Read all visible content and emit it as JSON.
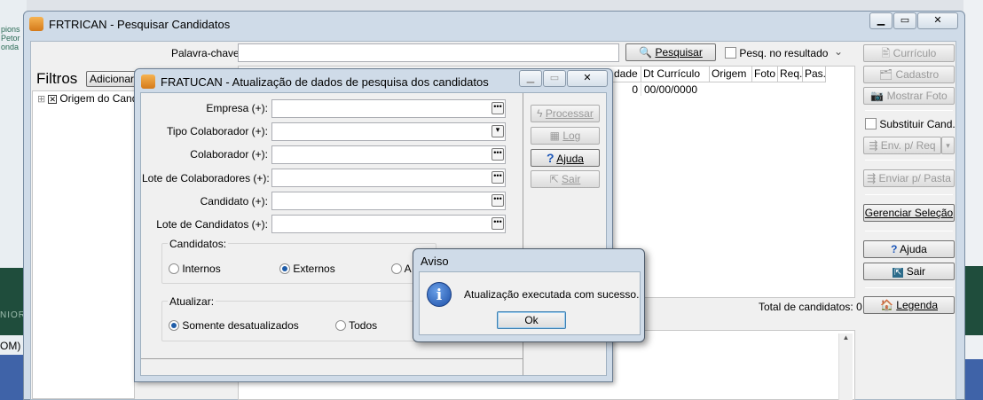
{
  "background": {
    "left_text": [
      "pions",
      "Petor",
      "onda"
    ],
    "left_text2": "NIOR",
    "left_text3": "OM)"
  },
  "main_window": {
    "title": "FRTRICAN - Pesquisar Candidatos",
    "search": {
      "keyword_label": "Palavra-chave:",
      "keyword_value": "",
      "search_button": "Pesquisar",
      "search_in_result_label": "Pesq. no resultado"
    },
    "filters": {
      "title": "Filtros",
      "add_button": "Adicionar",
      "tree_item": "Origem do Cand"
    },
    "grid": {
      "columns": [
        "dade",
        "Dt Currículo",
        "Origem",
        "Foto",
        "Req.",
        "Pas."
      ],
      "row": {
        "count": "0",
        "date": "00/00/0000"
      }
    },
    "total_label": "Total de candidatos: 0",
    "side_buttons": {
      "curriculo": "Currículo",
      "cadastro": "Cadastro",
      "mostrar_foto": "Mostrar Foto",
      "substituir": "Substituir Cand.",
      "env_req": "Env. p/ Req",
      "enviar_pasta": "Enviar p/ Pasta",
      "gerenciar": "Gerenciar Seleção",
      "ajuda": "Ajuda",
      "sair": "Sair",
      "legenda": "Legenda"
    }
  },
  "dialog": {
    "title": "FRATUCAN - Atualização de dados de pesquisa dos candidatos",
    "fields": [
      {
        "label": "Empresa (+):",
        "value": ""
      },
      {
        "label": "Tipo Colaborador (+):",
        "value": ""
      },
      {
        "label": "Colaborador (+):",
        "value": ""
      },
      {
        "label": "Lote de Colaboradores (+):",
        "value": ""
      },
      {
        "label": "Candidato (+):",
        "value": ""
      },
      {
        "label": "Lote de Candidatos (+):",
        "value": ""
      }
    ],
    "candidatos_group": {
      "label": "Candidatos:",
      "options": [
        "Internos",
        "Externos",
        "A"
      ],
      "selected": "Externos"
    },
    "atualizar_group": {
      "label": "Atualizar:",
      "options": [
        "Somente desatualizados",
        "Todos"
      ],
      "selected": "Somente desatualizados"
    },
    "buttons": {
      "processar": "Processar",
      "log": "Log",
      "ajuda": "Ajuda",
      "sair": "Sair"
    }
  },
  "aviso": {
    "title": "Aviso",
    "message": "Atualização executada com sucesso.",
    "ok": "Ok"
  }
}
